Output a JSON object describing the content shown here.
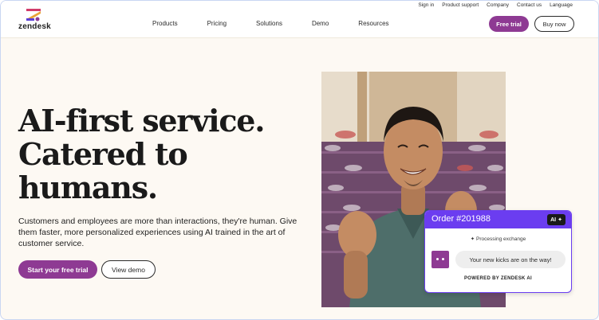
{
  "brand": {
    "name": "zendesk"
  },
  "utility_nav": [
    "Sign in",
    "Product support",
    "Company",
    "Contact us",
    "Language"
  ],
  "main_nav": [
    "Products",
    "Pricing",
    "Solutions",
    "Demo",
    "Resources"
  ],
  "header_buttons": {
    "free_trial": "Free trial",
    "buy_now": "Buy now"
  },
  "hero": {
    "title_lines": [
      "AI-first service.",
      "Catered to",
      "humans."
    ],
    "description": "Customers and employees are more than interactions, they're human. Give them faster, more personalized experiences using AI trained in the art of customer service.",
    "primary_cta": "Start your free trial",
    "secondary_cta": "View demo"
  },
  "ai_card": {
    "order_title": "Order #201988",
    "badge": "AI",
    "processing": "Processing exchange",
    "message": "Your new kicks are on the way!",
    "powered_by": "POWERED BY ZENDESK AI"
  },
  "colors": {
    "accent_purple": "#8e3a93",
    "card_violet": "#6b3df0",
    "page_bg": "#fdf9f3"
  }
}
